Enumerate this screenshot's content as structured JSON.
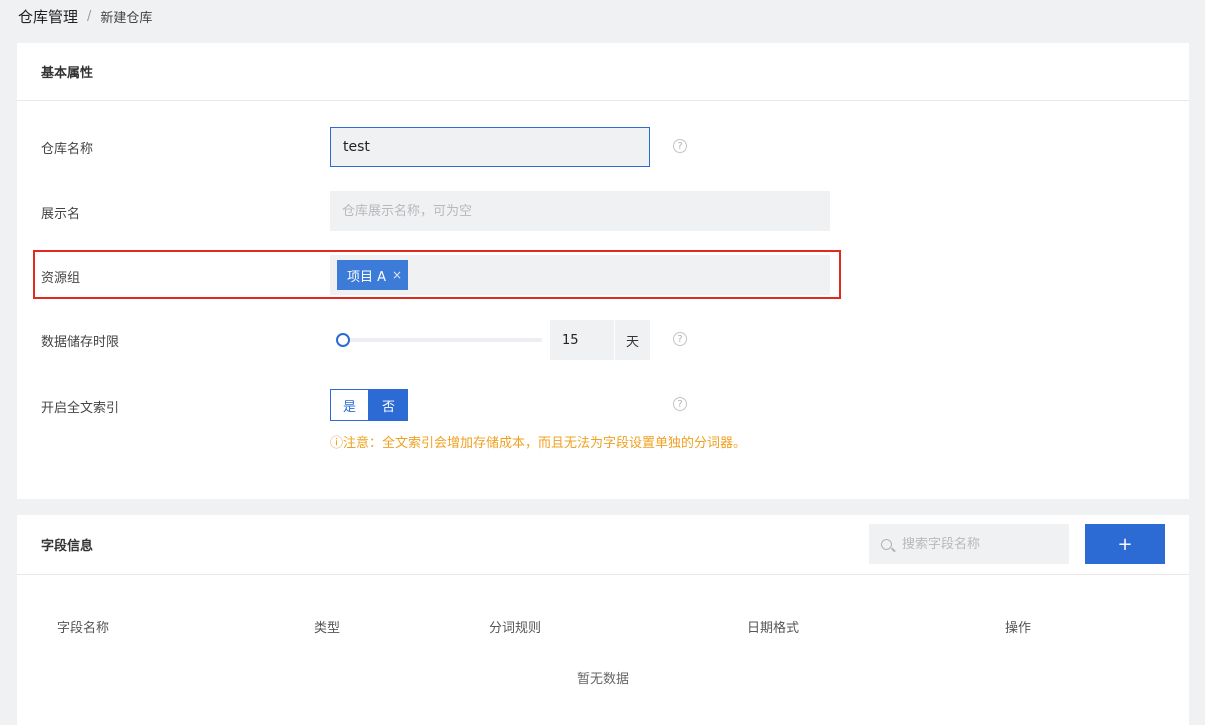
{
  "breadcrumb": {
    "root": "仓库管理",
    "separator": "/",
    "current": "新建仓库"
  },
  "basic": {
    "title": "基本属性",
    "warehouse_name": {
      "label": "仓库名称",
      "value": "test"
    },
    "display_name": {
      "label": "展示名",
      "placeholder": "仓库展示名称，可为空"
    },
    "resource_group": {
      "label": "资源组",
      "tags": [
        "项目 A"
      ],
      "tag_close": "×"
    },
    "retention": {
      "label": "数据储存时限",
      "value": "15",
      "unit": "天"
    },
    "fulltext": {
      "label": "开启全文索引",
      "options": [
        "是",
        "否"
      ],
      "selected": "否",
      "warning": "ⓘ注意：全文索引会增加存储成本，而且无法为字段设置单独的分词器。"
    },
    "help_glyph": "?"
  },
  "fields": {
    "title": "字段信息",
    "search_placeholder": "搜索字段名称",
    "add_label": "+",
    "columns": [
      "字段名称",
      "类型",
      "分词规则",
      "日期格式",
      "操作"
    ],
    "empty_text": "暂无数据"
  },
  "colors": {
    "primary": "#2d6bd4",
    "highlight": "#e02a1b",
    "warning": "#f0a020"
  }
}
